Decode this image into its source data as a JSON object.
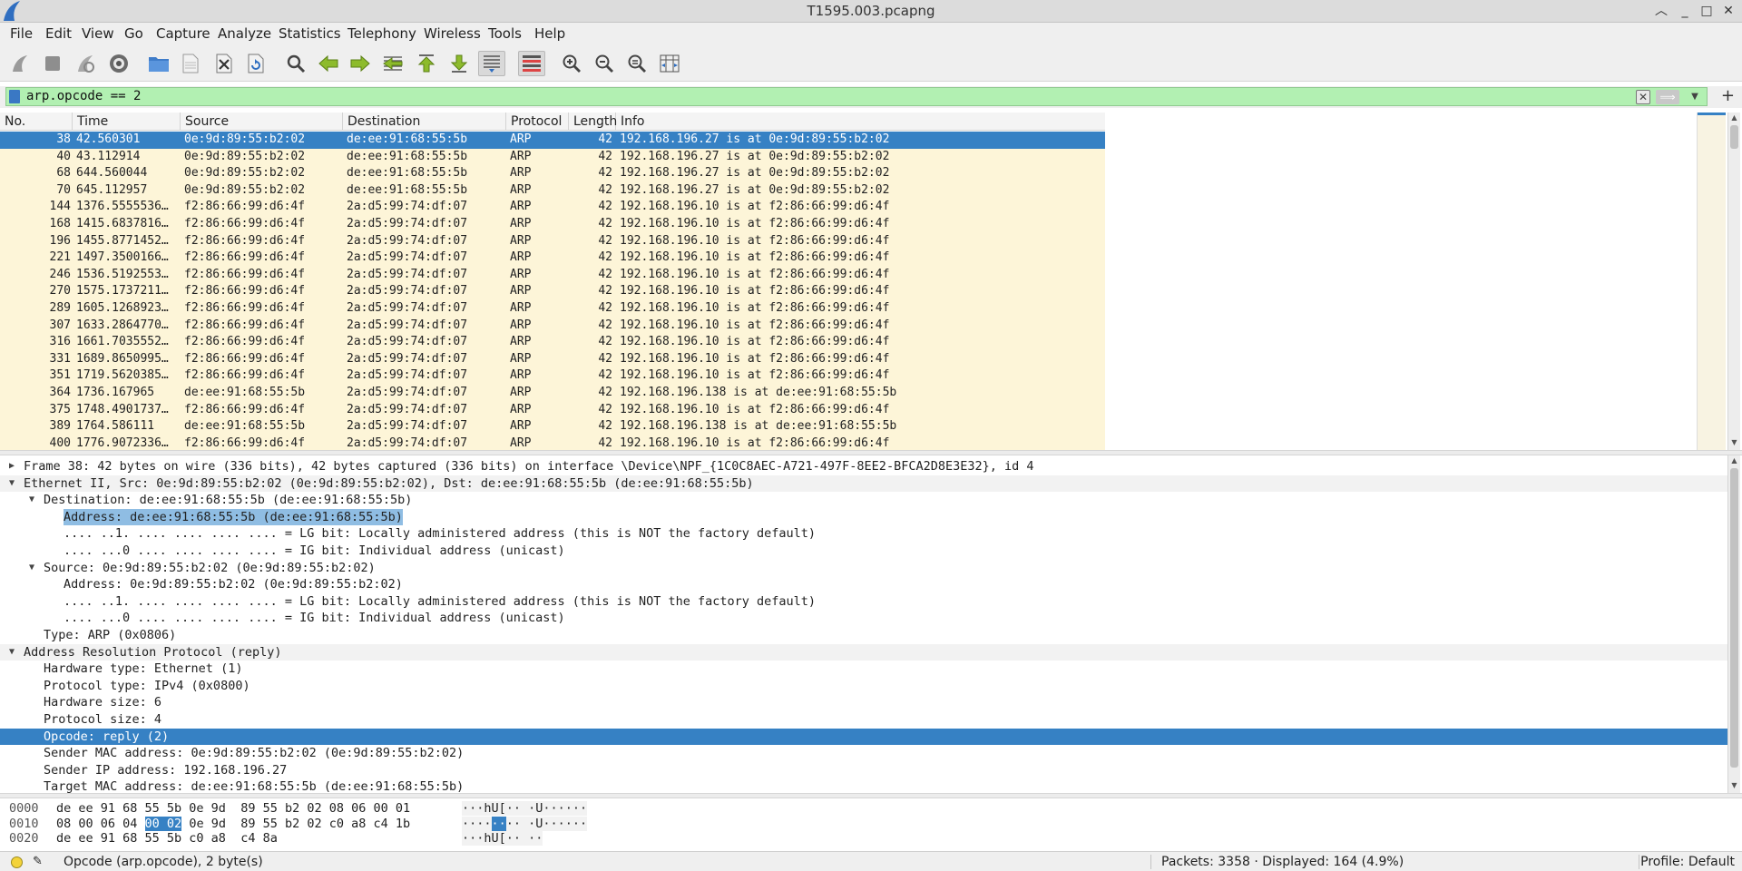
{
  "window": {
    "title": "T1595.003.pcapng"
  },
  "menu": [
    "File",
    "Edit",
    "View",
    "Go",
    "Capture",
    "Analyze",
    "Statistics",
    "Telephony",
    "Wireless",
    "Tools",
    "Help"
  ],
  "filter": {
    "value": "arp.opcode == 2"
  },
  "packet_list": {
    "columns": [
      "No.",
      "Time",
      "Source",
      "Destination",
      "Protocol",
      "Length",
      "Info"
    ],
    "rows": [
      {
        "no": "38",
        "time": "42.560301",
        "src": "0e:9d:89:55:b2:02",
        "dst": "de:ee:91:68:55:5b",
        "proto": "ARP",
        "len": "42",
        "info": "192.168.196.27 is at 0e:9d:89:55:b2:02",
        "selected": true
      },
      {
        "no": "40",
        "time": "43.112914",
        "src": "0e:9d:89:55:b2:02",
        "dst": "de:ee:91:68:55:5b",
        "proto": "ARP",
        "len": "42",
        "info": "192.168.196.27 is at 0e:9d:89:55:b2:02"
      },
      {
        "no": "68",
        "time": "644.560044",
        "src": "0e:9d:89:55:b2:02",
        "dst": "de:ee:91:68:55:5b",
        "proto": "ARP",
        "len": "42",
        "info": "192.168.196.27 is at 0e:9d:89:55:b2:02"
      },
      {
        "no": "70",
        "time": "645.112957",
        "src": "0e:9d:89:55:b2:02",
        "dst": "de:ee:91:68:55:5b",
        "proto": "ARP",
        "len": "42",
        "info": "192.168.196.27 is at 0e:9d:89:55:b2:02"
      },
      {
        "no": "144",
        "time": "1376.5555536…",
        "src": "f2:86:66:99:d6:4f",
        "dst": "2a:d5:99:74:df:07",
        "proto": "ARP",
        "len": "42",
        "info": "192.168.196.10 is at f2:86:66:99:d6:4f"
      },
      {
        "no": "168",
        "time": "1415.6837816…",
        "src": "f2:86:66:99:d6:4f",
        "dst": "2a:d5:99:74:df:07",
        "proto": "ARP",
        "len": "42",
        "info": "192.168.196.10 is at f2:86:66:99:d6:4f"
      },
      {
        "no": "196",
        "time": "1455.8771452…",
        "src": "f2:86:66:99:d6:4f",
        "dst": "2a:d5:99:74:df:07",
        "proto": "ARP",
        "len": "42",
        "info": "192.168.196.10 is at f2:86:66:99:d6:4f"
      },
      {
        "no": "221",
        "time": "1497.3500166…",
        "src": "f2:86:66:99:d6:4f",
        "dst": "2a:d5:99:74:df:07",
        "proto": "ARP",
        "len": "42",
        "info": "192.168.196.10 is at f2:86:66:99:d6:4f"
      },
      {
        "no": "246",
        "time": "1536.5192553…",
        "src": "f2:86:66:99:d6:4f",
        "dst": "2a:d5:99:74:df:07",
        "proto": "ARP",
        "len": "42",
        "info": "192.168.196.10 is at f2:86:66:99:d6:4f"
      },
      {
        "no": "270",
        "time": "1575.1737211…",
        "src": "f2:86:66:99:d6:4f",
        "dst": "2a:d5:99:74:df:07",
        "proto": "ARP",
        "len": "42",
        "info": "192.168.196.10 is at f2:86:66:99:d6:4f"
      },
      {
        "no": "289",
        "time": "1605.1268923…",
        "src": "f2:86:66:99:d6:4f",
        "dst": "2a:d5:99:74:df:07",
        "proto": "ARP",
        "len": "42",
        "info": "192.168.196.10 is at f2:86:66:99:d6:4f"
      },
      {
        "no": "307",
        "time": "1633.2864770…",
        "src": "f2:86:66:99:d6:4f",
        "dst": "2a:d5:99:74:df:07",
        "proto": "ARP",
        "len": "42",
        "info": "192.168.196.10 is at f2:86:66:99:d6:4f"
      },
      {
        "no": "316",
        "time": "1661.7035552…",
        "src": "f2:86:66:99:d6:4f",
        "dst": "2a:d5:99:74:df:07",
        "proto": "ARP",
        "len": "42",
        "info": "192.168.196.10 is at f2:86:66:99:d6:4f"
      },
      {
        "no": "331",
        "time": "1689.8650995…",
        "src": "f2:86:66:99:d6:4f",
        "dst": "2a:d5:99:74:df:07",
        "proto": "ARP",
        "len": "42",
        "info": "192.168.196.10 is at f2:86:66:99:d6:4f"
      },
      {
        "no": "351",
        "time": "1719.5620385…",
        "src": "f2:86:66:99:d6:4f",
        "dst": "2a:d5:99:74:df:07",
        "proto": "ARP",
        "len": "42",
        "info": "192.168.196.10 is at f2:86:66:99:d6:4f"
      },
      {
        "no": "364",
        "time": "1736.167965",
        "src": "de:ee:91:68:55:5b",
        "dst": "2a:d5:99:74:df:07",
        "proto": "ARP",
        "len": "42",
        "info": "192.168.196.138 is at de:ee:91:68:55:5b"
      },
      {
        "no": "375",
        "time": "1748.4901737…",
        "src": "f2:86:66:99:d6:4f",
        "dst": "2a:d5:99:74:df:07",
        "proto": "ARP",
        "len": "42",
        "info": "192.168.196.10 is at f2:86:66:99:d6:4f"
      },
      {
        "no": "389",
        "time": "1764.586111",
        "src": "de:ee:91:68:55:5b",
        "dst": "2a:d5:99:74:df:07",
        "proto": "ARP",
        "len": "42",
        "info": "192.168.196.138 is at de:ee:91:68:55:5b"
      },
      {
        "no": "400",
        "time": "1776.9072336…",
        "src": "f2:86:66:99:d6:4f",
        "dst": "2a:d5:99:74:df:07",
        "proto": "ARP",
        "len": "42",
        "info": "192.168.196.10 is at f2:86:66:99:d6:4f"
      }
    ]
  },
  "details": [
    {
      "level": 0,
      "arrow": "right",
      "text": "Frame 38: 42 bytes on wire (336 bits), 42 bytes captured (336 bits) on interface \\Device\\NPF_{1C0C8AEC-A721-497F-8EE2-BFCA2D8E3E32}, id 4"
    },
    {
      "level": 0,
      "arrow": "down",
      "text": "Ethernet II, Src: 0e:9d:89:55:b2:02 (0e:9d:89:55:b2:02), Dst: de:ee:91:68:55:5b (de:ee:91:68:55:5b)",
      "alt": true
    },
    {
      "level": 1,
      "arrow": "down",
      "text": "Destination: de:ee:91:68:55:5b (de:ee:91:68:55:5b)"
    },
    {
      "level": 2,
      "arrow": "",
      "text": "Address: de:ee:91:68:55:5b (de:ee:91:68:55:5b)",
      "related": true
    },
    {
      "level": 2,
      "arrow": "",
      "text": ".... ..1. .... .... .... .... = LG bit: Locally administered address (this is NOT the factory default)"
    },
    {
      "level": 2,
      "arrow": "",
      "text": ".... ...0 .... .... .... .... = IG bit: Individual address (unicast)"
    },
    {
      "level": 1,
      "arrow": "down",
      "text": "Source: 0e:9d:89:55:b2:02 (0e:9d:89:55:b2:02)"
    },
    {
      "level": 2,
      "arrow": "",
      "text": "Address: 0e:9d:89:55:b2:02 (0e:9d:89:55:b2:02)"
    },
    {
      "level": 2,
      "arrow": "",
      "text": ".... ..1. .... .... .... .... = LG bit: Locally administered address (this is NOT the factory default)"
    },
    {
      "level": 2,
      "arrow": "",
      "text": ".... ...0 .... .... .... .... = IG bit: Individual address (unicast)"
    },
    {
      "level": 1,
      "arrow": "",
      "text": "Type: ARP (0x0806)"
    },
    {
      "level": 0,
      "arrow": "down",
      "text": "Address Resolution Protocol (reply)",
      "alt": true
    },
    {
      "level": 1,
      "arrow": "",
      "text": "Hardware type: Ethernet (1)"
    },
    {
      "level": 1,
      "arrow": "",
      "text": "Protocol type: IPv4 (0x0800)"
    },
    {
      "level": 1,
      "arrow": "",
      "text": "Hardware size: 6"
    },
    {
      "level": 1,
      "arrow": "",
      "text": "Protocol size: 4"
    },
    {
      "level": 1,
      "arrow": "",
      "text": "Opcode: reply (2)",
      "selected": true
    },
    {
      "level": 1,
      "arrow": "",
      "text": "Sender MAC address: 0e:9d:89:55:b2:02 (0e:9d:89:55:b2:02)"
    },
    {
      "level": 1,
      "arrow": "",
      "text": "Sender IP address: 192.168.196.27"
    },
    {
      "level": 1,
      "arrow": "",
      "text": "Target MAC address: de:ee:91:68:55:5b (de:ee:91:68:55:5b)"
    }
  ],
  "bytes": [
    {
      "offset": "0000",
      "hex_pre": "de ee 91 68 55 5b 0e 9d  89 55 b2 02 08 06 00 01",
      "hex_sel": "",
      "hex_post": "",
      "ascii_pre": "···hU[·· ·U······",
      "ascii_sel": "",
      "ascii_post": ""
    },
    {
      "offset": "0010",
      "hex_pre": "08 00 06 04 ",
      "hex_sel": "00 02",
      "hex_post": " 0e 9d  89 55 b2 02 c0 a8 c4 1b",
      "ascii_pre": "····",
      "ascii_sel": "··",
      "ascii_post": "·· ·U······"
    },
    {
      "offset": "0020",
      "hex_pre": "de ee 91 68 55 5b c0 a8  c4 8a",
      "hex_sel": "",
      "hex_post": "",
      "ascii_pre": "···hU[·· ··",
      "ascii_sel": "",
      "ascii_post": ""
    }
  ],
  "status": {
    "field": "Opcode (arp.opcode), 2 byte(s)",
    "packets": "Packets: 3358 · Displayed: 164 (4.9%)",
    "profile": "Profile: Default"
  },
  "colors": {
    "selection": "#3681c4",
    "filter_ok": "#b2f0b2",
    "arp_row": "#fdf5d8"
  }
}
